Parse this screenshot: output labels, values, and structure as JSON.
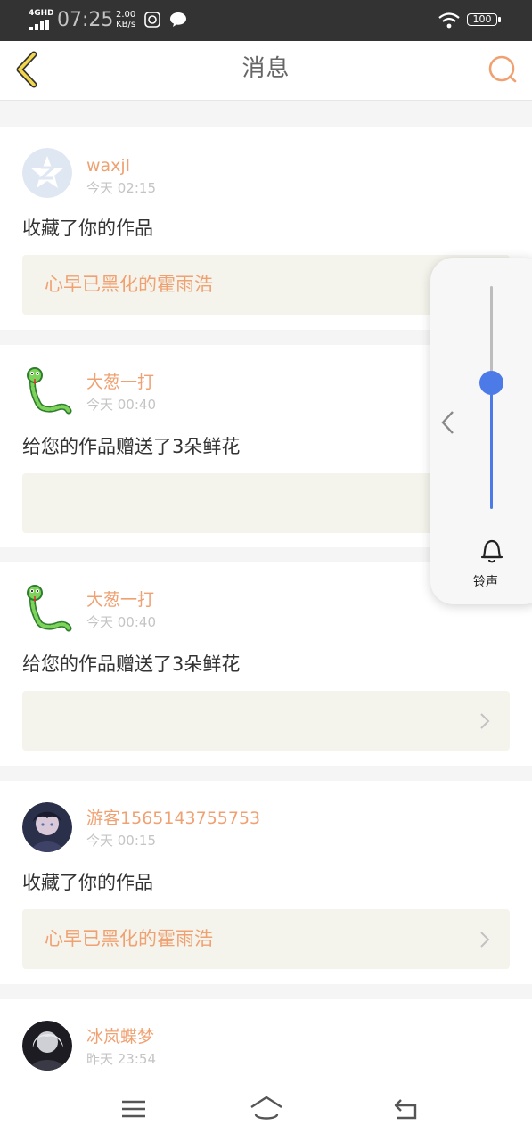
{
  "status_bar": {
    "network": "4GHD",
    "time": "07:25",
    "speed_value": "2.00",
    "speed_unit": "KB/s",
    "battery": "100"
  },
  "header": {
    "title": "消息"
  },
  "messages": [
    {
      "username": "waxjl",
      "time": "今天 02:15",
      "action": "收藏了你的作品",
      "work_title": "心早已黑化的霍雨浩",
      "avatar_icon": "qq-zone-avatar"
    },
    {
      "username": "大葱一打",
      "time": "今天 00:40",
      "action": "给您的作品赠送了3朵鲜花",
      "work_title": "",
      "avatar_icon": "green-snake-avatar"
    },
    {
      "username": "大葱一打",
      "time": "今天 00:40",
      "action": "给您的作品赠送了3朵鲜花",
      "work_title": "",
      "avatar_icon": "green-snake-avatar"
    },
    {
      "username": "游客1565143755753",
      "time": "今天 00:15",
      "action": "收藏了你的作品",
      "work_title": "心早已黑化的霍雨浩",
      "avatar_icon": "anime-character-avatar"
    },
    {
      "username": "冰岚蝶梦",
      "time": "昨天 23:54",
      "action": "",
      "work_title": "",
      "avatar_icon": "anime-character-avatar"
    }
  ],
  "volume_panel": {
    "label": "铃声",
    "level": 0.57,
    "accent": "#4c7be8"
  },
  "colors": {
    "accent": "#f0a172",
    "status_bar": "#333333",
    "work_bg": "#f4f4ec"
  }
}
